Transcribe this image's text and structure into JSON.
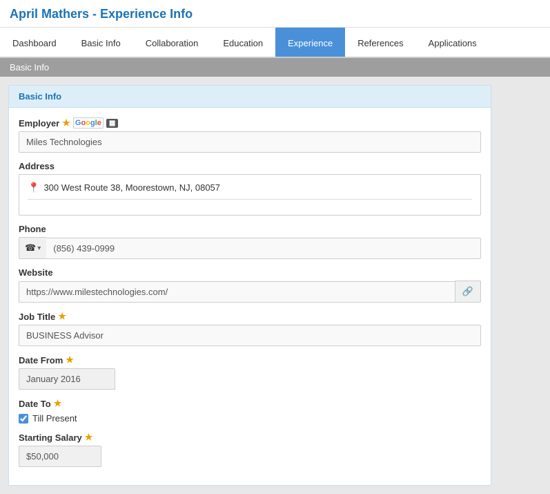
{
  "page": {
    "title": "April Mathers - Experience Info"
  },
  "nav": {
    "tabs": [
      {
        "id": "dashboard",
        "label": "Dashboard",
        "active": false
      },
      {
        "id": "basic-info",
        "label": "Basic Info",
        "active": false
      },
      {
        "id": "collaboration",
        "label": "Collaboration",
        "active": false
      },
      {
        "id": "education",
        "label": "Education",
        "active": false
      },
      {
        "id": "experience",
        "label": "Experience",
        "active": true
      },
      {
        "id": "references",
        "label": "References",
        "active": false
      },
      {
        "id": "applications",
        "label": "Applications",
        "active": false
      }
    ]
  },
  "breadcrumb": {
    "label": "Basic Info"
  },
  "card": {
    "header": "Basic Info",
    "fields": {
      "employer_label": "Employer",
      "employer_value": "Miles Technologies",
      "address_label": "Address",
      "address_value": "300 West Route 38, Moorestown, NJ, 08057",
      "phone_label": "Phone",
      "phone_prefix": "📞",
      "phone_value": "(856) 439-0999",
      "website_label": "Website",
      "website_value": "https://www.milestechnologies.com/",
      "website_icon": "🔗",
      "job_title_label": "Job Title",
      "job_title_value": "BUSINESS Advisor",
      "date_from_label": "Date From",
      "date_from_value": "January 2016",
      "date_to_label": "Date To",
      "till_present_label": "Till Present",
      "starting_salary_label": "Starting Salary",
      "starting_salary_value": "$50,000"
    }
  }
}
